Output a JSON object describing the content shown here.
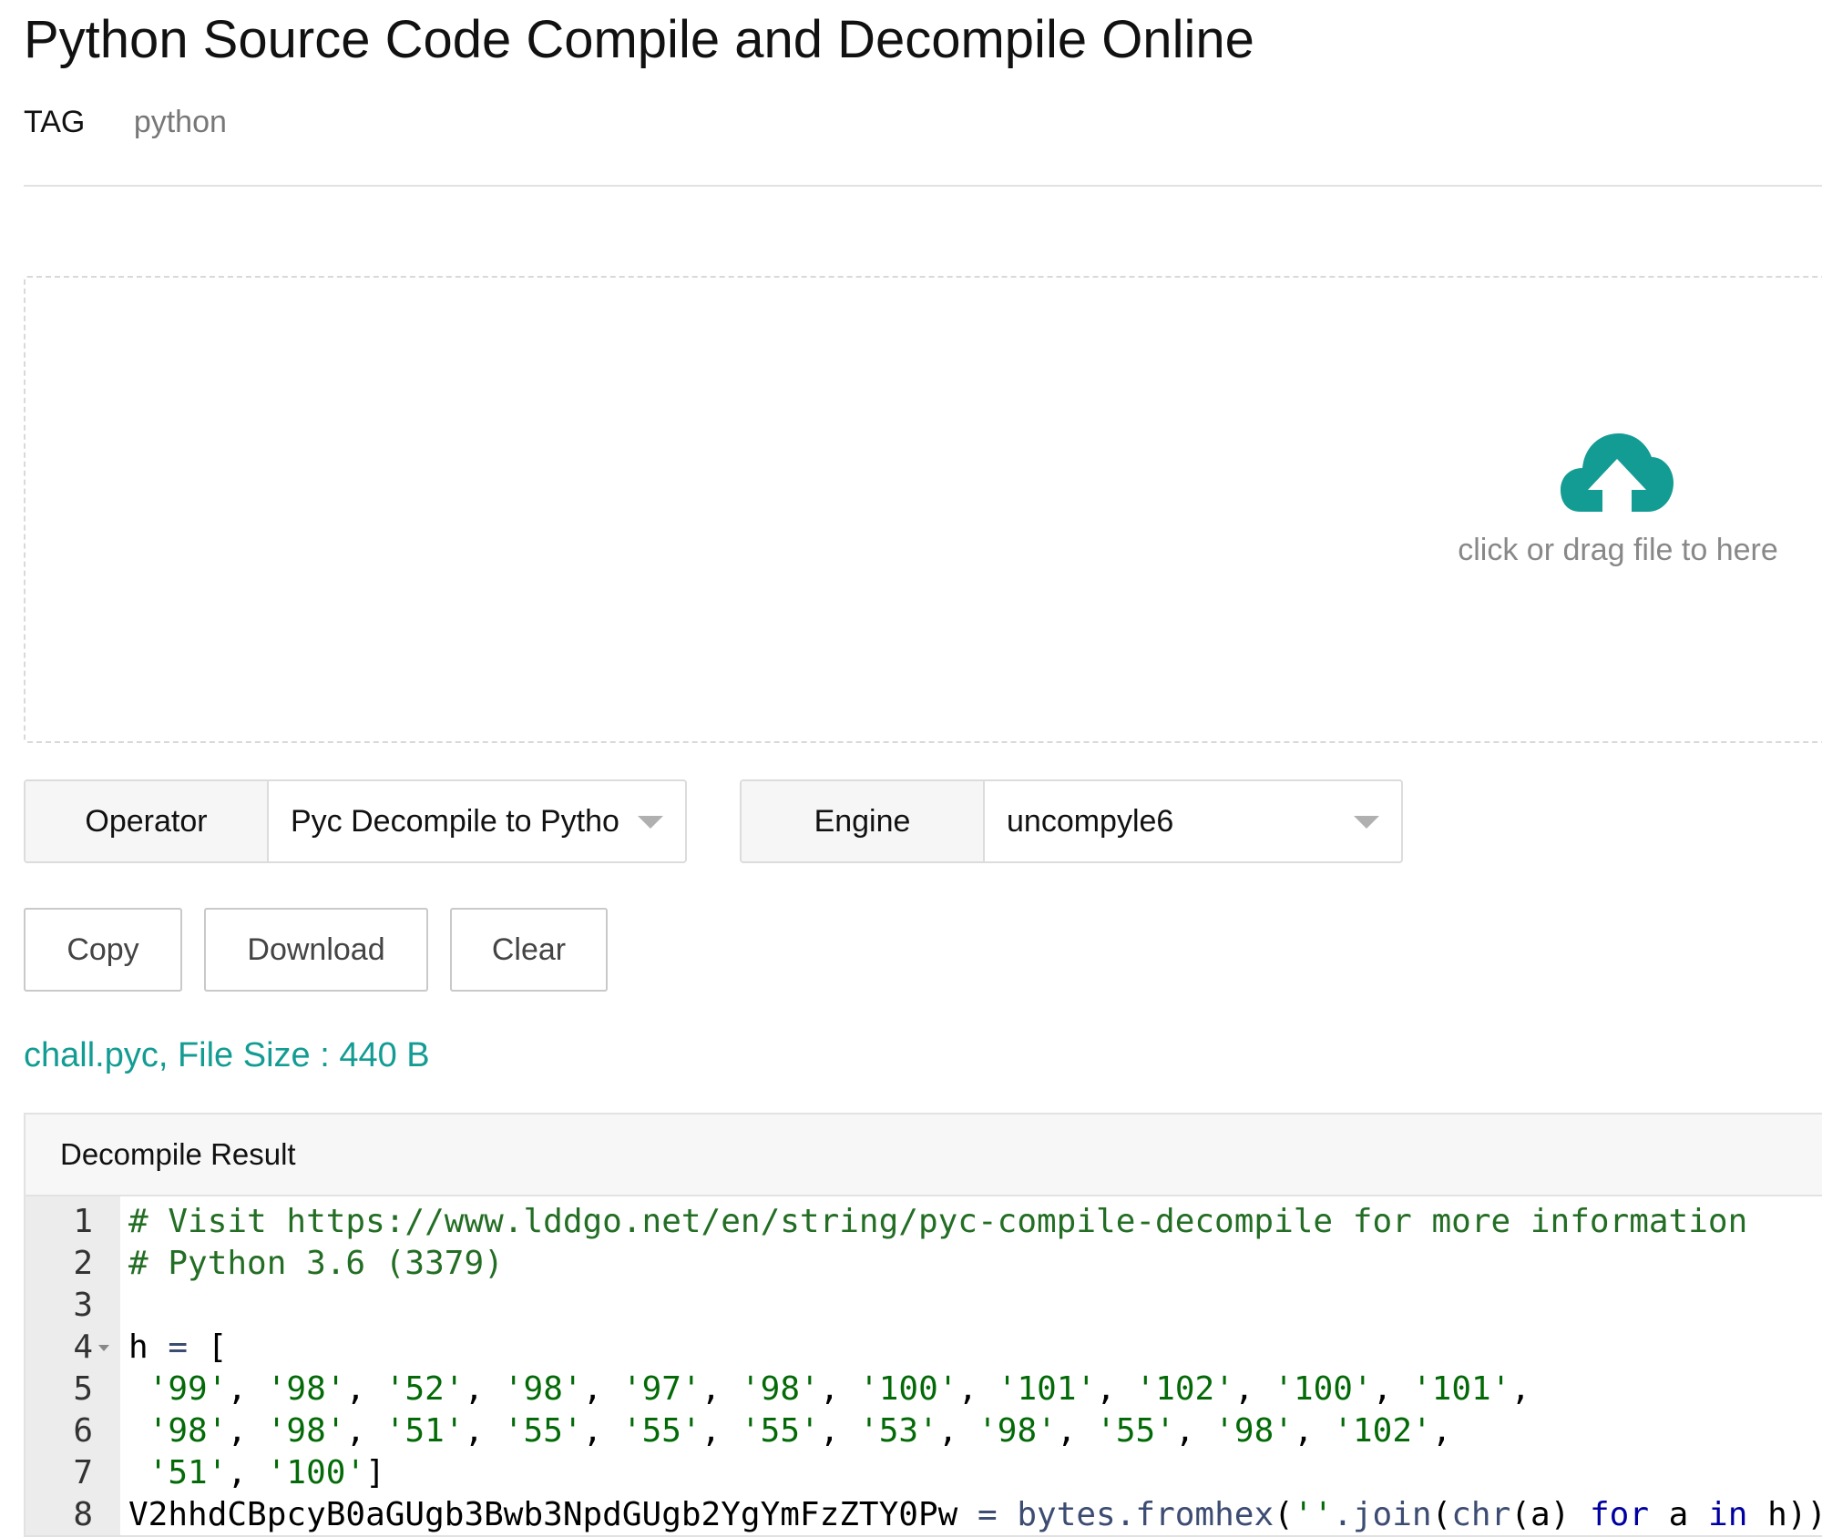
{
  "title": "Python Source Code Compile and Decompile Online",
  "tag": {
    "label": "TAG",
    "value": "python"
  },
  "upload": {
    "hint": "click or drag file to here",
    "icon": "cloud-upload-icon"
  },
  "operator": {
    "label": "Operator",
    "value": "Pyc Decompile to Pytho"
  },
  "engine": {
    "label": "Engine",
    "value": "uncompyle6"
  },
  "buttons": {
    "copy": "Copy",
    "download": "Download",
    "clear": "Clear"
  },
  "file_info": "chall.pyc, File Size : 440 B",
  "result": {
    "header": "Decompile Result",
    "lines": [
      {
        "num": "1",
        "parts": [
          {
            "t": "comment",
            "text": "# Visit https://www.lddgo.net/en/string/pyc-compile-decompile for more information"
          }
        ]
      },
      {
        "num": "2",
        "parts": [
          {
            "t": "comment",
            "text": "# Python 3.6 (3379)"
          }
        ]
      },
      {
        "num": "3",
        "parts": []
      },
      {
        "num": "4",
        "fold": true,
        "parts": [
          {
            "t": "plain",
            "text": "h "
          },
          {
            "t": "op",
            "text": "="
          },
          {
            "t": "plain",
            "text": " ["
          }
        ]
      },
      {
        "num": "5",
        "parts": [
          {
            "t": "plain",
            "text": " "
          },
          {
            "t": "str",
            "text": "'99'"
          },
          {
            "t": "plain",
            "text": ", "
          },
          {
            "t": "str",
            "text": "'98'"
          },
          {
            "t": "plain",
            "text": ", "
          },
          {
            "t": "str",
            "text": "'52'"
          },
          {
            "t": "plain",
            "text": ", "
          },
          {
            "t": "str",
            "text": "'98'"
          },
          {
            "t": "plain",
            "text": ", "
          },
          {
            "t": "str",
            "text": "'97'"
          },
          {
            "t": "plain",
            "text": ", "
          },
          {
            "t": "str",
            "text": "'98'"
          },
          {
            "t": "plain",
            "text": ", "
          },
          {
            "t": "str",
            "text": "'100'"
          },
          {
            "t": "plain",
            "text": ", "
          },
          {
            "t": "str",
            "text": "'101'"
          },
          {
            "t": "plain",
            "text": ", "
          },
          {
            "t": "str",
            "text": "'102'"
          },
          {
            "t": "plain",
            "text": ", "
          },
          {
            "t": "str",
            "text": "'100'"
          },
          {
            "t": "plain",
            "text": ", "
          },
          {
            "t": "str",
            "text": "'101'"
          },
          {
            "t": "plain",
            "text": ","
          }
        ]
      },
      {
        "num": "6",
        "parts": [
          {
            "t": "plain",
            "text": " "
          },
          {
            "t": "str",
            "text": "'98'"
          },
          {
            "t": "plain",
            "text": ", "
          },
          {
            "t": "str",
            "text": "'98'"
          },
          {
            "t": "plain",
            "text": ", "
          },
          {
            "t": "str",
            "text": "'51'"
          },
          {
            "t": "plain",
            "text": ", "
          },
          {
            "t": "str",
            "text": "'55'"
          },
          {
            "t": "plain",
            "text": ", "
          },
          {
            "t": "str",
            "text": "'55'"
          },
          {
            "t": "plain",
            "text": ", "
          },
          {
            "t": "str",
            "text": "'55'"
          },
          {
            "t": "plain",
            "text": ", "
          },
          {
            "t": "str",
            "text": "'53'"
          },
          {
            "t": "plain",
            "text": ", "
          },
          {
            "t": "str",
            "text": "'98'"
          },
          {
            "t": "plain",
            "text": ", "
          },
          {
            "t": "str",
            "text": "'55'"
          },
          {
            "t": "plain",
            "text": ", "
          },
          {
            "t": "str",
            "text": "'98'"
          },
          {
            "t": "plain",
            "text": ", "
          },
          {
            "t": "str",
            "text": "'102'"
          },
          {
            "t": "plain",
            "text": ","
          }
        ]
      },
      {
        "num": "7",
        "parts": [
          {
            "t": "plain",
            "text": " "
          },
          {
            "t": "str",
            "text": "'51'"
          },
          {
            "t": "plain",
            "text": ", "
          },
          {
            "t": "str",
            "text": "'100'"
          },
          {
            "t": "plain",
            "text": "]"
          }
        ]
      },
      {
        "num": "8",
        "parts": [
          {
            "t": "plain",
            "text": "V2hhdCBpcyB0aGUgb3Bwb3NpdGUgb2YgYmFzZTY0Pw "
          },
          {
            "t": "op",
            "text": "="
          },
          {
            "t": "plain",
            "text": " "
          },
          {
            "t": "fn",
            "text": "bytes.fromhex"
          },
          {
            "t": "plain",
            "text": "("
          },
          {
            "t": "str",
            "text": "''"
          },
          {
            "t": "fn",
            "text": ".join"
          },
          {
            "t": "plain",
            "text": "("
          },
          {
            "t": "fn",
            "text": "chr"
          },
          {
            "t": "plain",
            "text": "(a) "
          },
          {
            "t": "kw",
            "text": "for"
          },
          {
            "t": "plain",
            "text": " a "
          },
          {
            "t": "kw",
            "text": "in"
          },
          {
            "t": "plain",
            "text": " h))"
          }
        ]
      }
    ]
  },
  "colors": {
    "accent": "#139c93",
    "border": "#dcdcdc",
    "gutter": "#ececec"
  }
}
